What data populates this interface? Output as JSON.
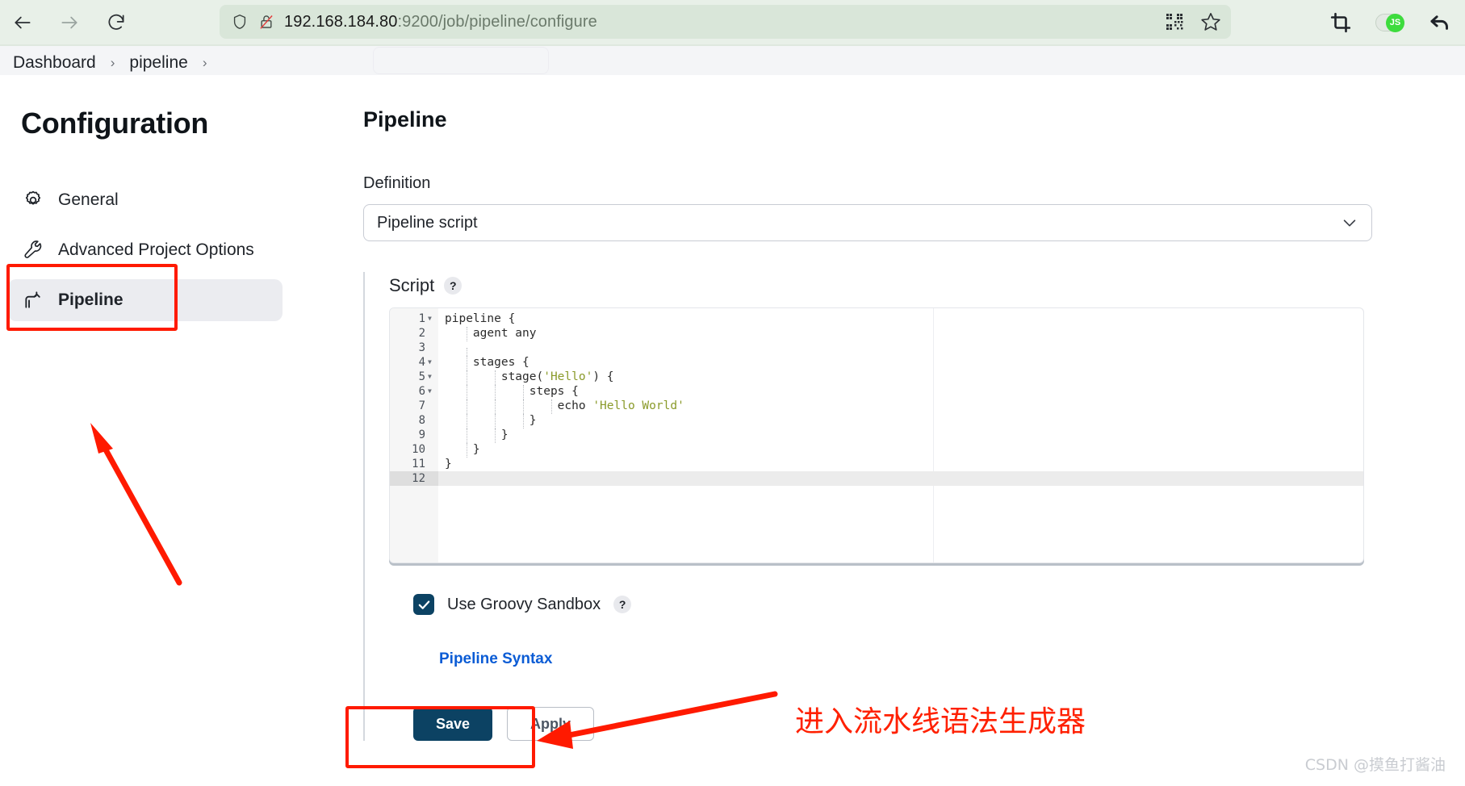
{
  "browser": {
    "back_label": "Back",
    "forward_label": "Forward",
    "reload_label": "Reload",
    "url_host": "192.168.184.80",
    "url_rest": ":9200/job/pipeline/configure",
    "shield_icon": "shield-icon",
    "insecure_icon": "insecure-connection-icon",
    "qr_icon": "qr-code-icon",
    "bookmark_icon": "star-bookmark-icon",
    "crop_icon": "crop-capture-icon",
    "js_toggle_label": "JS",
    "undo_icon": "undo-arrow-icon"
  },
  "breadcrumb": {
    "items": [
      {
        "label": "Dashboard"
      },
      {
        "label": "pipeline"
      }
    ],
    "separator": "›"
  },
  "sidebar": {
    "title": "Configuration",
    "items": [
      {
        "label": "General",
        "icon": "gear-icon",
        "active": false
      },
      {
        "label": "Advanced Project Options",
        "icon": "wrench-icon",
        "active": false
      },
      {
        "label": "Pipeline",
        "icon": "pipeline-icon",
        "active": true
      }
    ]
  },
  "main": {
    "title": "Pipeline",
    "definition_label": "Definition",
    "definition_value": "Pipeline script",
    "definition_options": [
      "Pipeline script"
    ],
    "script_label": "Script",
    "help_badge": "?",
    "sandbox_label": "Use Groovy Sandbox",
    "sandbox_checked": true,
    "sandbox_help": "?",
    "syntax_link": "Pipeline Syntax",
    "save_label": "Save",
    "apply_label": "Apply"
  },
  "editor": {
    "active_line": 12,
    "lines": [
      {
        "n": 1,
        "fold": true,
        "indent": 0,
        "text": "pipeline {"
      },
      {
        "n": 2,
        "fold": false,
        "indent": 1,
        "text": "    agent any"
      },
      {
        "n": 3,
        "fold": false,
        "indent": 1,
        "text": ""
      },
      {
        "n": 4,
        "fold": true,
        "indent": 1,
        "text": "    stages {"
      },
      {
        "n": 5,
        "fold": true,
        "indent": 2,
        "text": "        stage('Hello') {"
      },
      {
        "n": 6,
        "fold": true,
        "indent": 3,
        "text": "            steps {"
      },
      {
        "n": 7,
        "fold": false,
        "indent": 4,
        "text": "                echo 'Hello World'"
      },
      {
        "n": 8,
        "fold": false,
        "indent": 3,
        "text": "            }"
      },
      {
        "n": 9,
        "fold": false,
        "indent": 2,
        "text": "        }"
      },
      {
        "n": 10,
        "fold": false,
        "indent": 1,
        "text": "    }"
      },
      {
        "n": 11,
        "fold": false,
        "indent": 0,
        "text": "}"
      },
      {
        "n": 12,
        "fold": false,
        "indent": 0,
        "text": ""
      }
    ]
  },
  "annotations": {
    "note_text": "进入流水线语法生成器",
    "highlight_color": "#ff1a00"
  },
  "watermark": {
    "text": "CSDN @摸鱼打酱油"
  },
  "colors": {
    "accent_navy": "#0c4263",
    "link_blue": "#0b5cd5",
    "annotation_red": "#ff1a00",
    "browser_green": "#e8f0e8"
  }
}
